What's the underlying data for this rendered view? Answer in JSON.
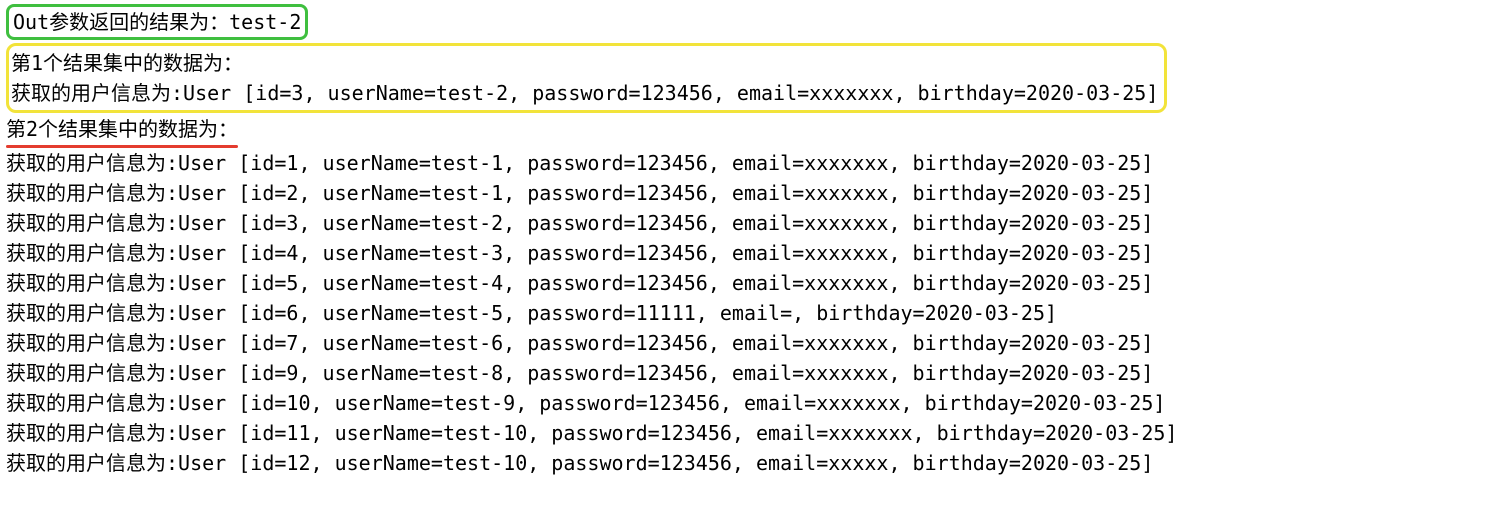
{
  "outParamLine": "Out参数返回的结果为：test-2",
  "resultSet1": {
    "header": "第1个结果集中的数据为：",
    "rows": [
      "获取的用户信息为:User [id=3, userName=test-2, password=123456, email=xxxxxxx, birthday=2020-03-25]"
    ]
  },
  "resultSet2": {
    "header": "第2个结果集中的数据为：",
    "rows": [
      "获取的用户信息为:User [id=1, userName=test-1, password=123456, email=xxxxxxx, birthday=2020-03-25]",
      "获取的用户信息为:User [id=2, userName=test-1, password=123456, email=xxxxxxx, birthday=2020-03-25]",
      "获取的用户信息为:User [id=3, userName=test-2, password=123456, email=xxxxxxx, birthday=2020-03-25]",
      "获取的用户信息为:User [id=4, userName=test-3, password=123456, email=xxxxxxx, birthday=2020-03-25]",
      "获取的用户信息为:User [id=5, userName=test-4, password=123456, email=xxxxxxx, birthday=2020-03-25]",
      "获取的用户信息为:User [id=6, userName=test-5, password=11111, email=, birthday=2020-03-25]",
      "获取的用户信息为:User [id=7, userName=test-6, password=123456, email=xxxxxxx, birthday=2020-03-25]",
      "获取的用户信息为:User [id=9, userName=test-8, password=123456, email=xxxxxxx, birthday=2020-03-25]",
      "获取的用户信息为:User [id=10, userName=test-9, password=123456, email=xxxxxxx, birthday=2020-03-25]",
      "获取的用户信息为:User [id=11, userName=test-10, password=123456, email=xxxxxxx, birthday=2020-03-25]",
      "获取的用户信息为:User [id=12, userName=test-10, password=123456, email=xxxxx, birthday=2020-03-25]"
    ]
  }
}
